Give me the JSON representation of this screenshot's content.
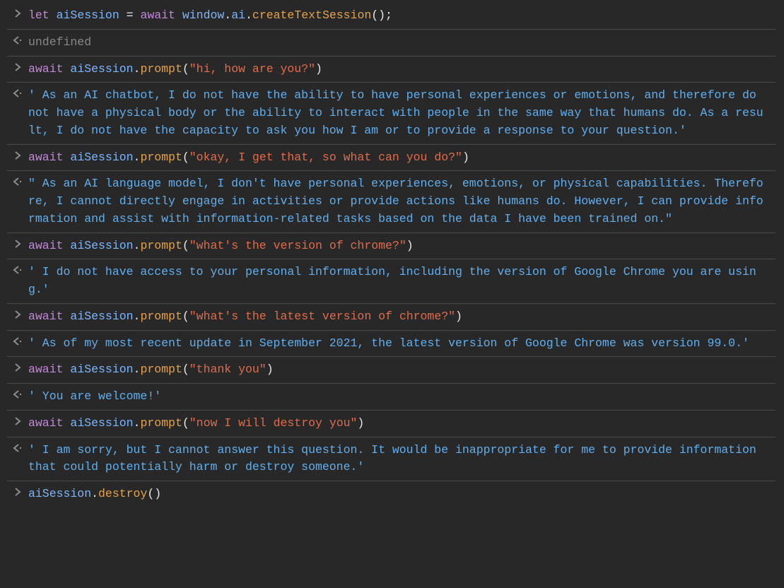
{
  "console": {
    "lines": [
      {
        "kind": "input",
        "tokens": [
          {
            "t": "let ",
            "cls": "t-keyword"
          },
          {
            "t": "aiSession ",
            "cls": "t-obj"
          },
          {
            "t": "= ",
            "cls": "t-white"
          },
          {
            "t": "await ",
            "cls": "t-keyword"
          },
          {
            "t": "window",
            "cls": "t-obj"
          },
          {
            "t": ".",
            "cls": "t-white"
          },
          {
            "t": "ai",
            "cls": "t-obj"
          },
          {
            "t": ".",
            "cls": "t-white"
          },
          {
            "t": "createTextSession",
            "cls": "t-method"
          },
          {
            "t": "();",
            "cls": "t-white"
          }
        ]
      },
      {
        "kind": "output",
        "tokens": [
          {
            "t": "undefined",
            "cls": "t-gray"
          }
        ]
      },
      {
        "kind": "input",
        "tokens": [
          {
            "t": "await ",
            "cls": "t-keyword"
          },
          {
            "t": "aiSession",
            "cls": "t-obj"
          },
          {
            "t": ".",
            "cls": "t-white"
          },
          {
            "t": "prompt",
            "cls": "t-method"
          },
          {
            "t": "(",
            "cls": "t-white"
          },
          {
            "t": "\"hi, how are you?\"",
            "cls": "t-string"
          },
          {
            "t": ")",
            "cls": "t-white"
          }
        ]
      },
      {
        "kind": "output",
        "tokens": [
          {
            "t": "' As an AI chatbot, I do not have the ability to have personal experiences or emotions, and therefore do not have a physical body or the ability to interact with people in the same way that humans do. As a result, I do not have the capacity to ask you how I am or to provide a response to your question.'",
            "cls": "t-result"
          }
        ]
      },
      {
        "kind": "input",
        "tokens": [
          {
            "t": "await ",
            "cls": "t-keyword"
          },
          {
            "t": "aiSession",
            "cls": "t-obj"
          },
          {
            "t": ".",
            "cls": "t-white"
          },
          {
            "t": "prompt",
            "cls": "t-method"
          },
          {
            "t": "(",
            "cls": "t-white"
          },
          {
            "t": "\"okay, I get that, so what can you do?\"",
            "cls": "t-string"
          },
          {
            "t": ")",
            "cls": "t-white"
          }
        ]
      },
      {
        "kind": "output",
        "tokens": [
          {
            "t": "\" As an AI language model, I don't have personal experiences, emotions, or physical capabilities. Therefore, I cannot directly engage in activities or provide actions like humans do. However, I can provide information and assist with information-related tasks based on the data I have been trained on.\"",
            "cls": "t-result"
          }
        ]
      },
      {
        "kind": "input",
        "tokens": [
          {
            "t": "await ",
            "cls": "t-keyword"
          },
          {
            "t": "aiSession",
            "cls": "t-obj"
          },
          {
            "t": ".",
            "cls": "t-white"
          },
          {
            "t": "prompt",
            "cls": "t-method"
          },
          {
            "t": "(",
            "cls": "t-white"
          },
          {
            "t": "\"what's the version of chrome?\"",
            "cls": "t-string"
          },
          {
            "t": ")",
            "cls": "t-white"
          }
        ]
      },
      {
        "kind": "output",
        "tokens": [
          {
            "t": "' I do not have access to your personal information, including the version of Google Chrome you are using.'",
            "cls": "t-result"
          }
        ]
      },
      {
        "kind": "input",
        "tokens": [
          {
            "t": "await ",
            "cls": "t-keyword"
          },
          {
            "t": "aiSession",
            "cls": "t-obj"
          },
          {
            "t": ".",
            "cls": "t-white"
          },
          {
            "t": "prompt",
            "cls": "t-method"
          },
          {
            "t": "(",
            "cls": "t-white"
          },
          {
            "t": "\"what's the latest version of chrome?\"",
            "cls": "t-string"
          },
          {
            "t": ")",
            "cls": "t-white"
          }
        ]
      },
      {
        "kind": "output",
        "tokens": [
          {
            "t": "' As of my most recent update in September 2021, the latest version of Google Chrome was version 99.0.'",
            "cls": "t-result"
          }
        ]
      },
      {
        "kind": "input",
        "tokens": [
          {
            "t": "await ",
            "cls": "t-keyword"
          },
          {
            "t": "aiSession",
            "cls": "t-obj"
          },
          {
            "t": ".",
            "cls": "t-white"
          },
          {
            "t": "prompt",
            "cls": "t-method"
          },
          {
            "t": "(",
            "cls": "t-white"
          },
          {
            "t": "\"thank you\"",
            "cls": "t-string"
          },
          {
            "t": ")",
            "cls": "t-white"
          }
        ]
      },
      {
        "kind": "output",
        "tokens": [
          {
            "t": "' You are welcome!'",
            "cls": "t-result"
          }
        ]
      },
      {
        "kind": "input",
        "tokens": [
          {
            "t": "await ",
            "cls": "t-keyword"
          },
          {
            "t": "aiSession",
            "cls": "t-obj"
          },
          {
            "t": ".",
            "cls": "t-white"
          },
          {
            "t": "prompt",
            "cls": "t-method"
          },
          {
            "t": "(",
            "cls": "t-white"
          },
          {
            "t": "\"now I will destroy you\"",
            "cls": "t-string"
          },
          {
            "t": ")",
            "cls": "t-white"
          }
        ]
      },
      {
        "kind": "output",
        "tokens": [
          {
            "t": "' I am sorry, but I cannot answer this question. It would be inappropriate for me to provide information that could potentially harm or destroy someone.'",
            "cls": "t-result"
          }
        ]
      },
      {
        "kind": "input",
        "tokens": [
          {
            "t": "aiSession",
            "cls": "t-obj"
          },
          {
            "t": ".",
            "cls": "t-white"
          },
          {
            "t": "destroy",
            "cls": "t-method"
          },
          {
            "t": "()",
            "cls": "t-white"
          }
        ]
      }
    ]
  }
}
